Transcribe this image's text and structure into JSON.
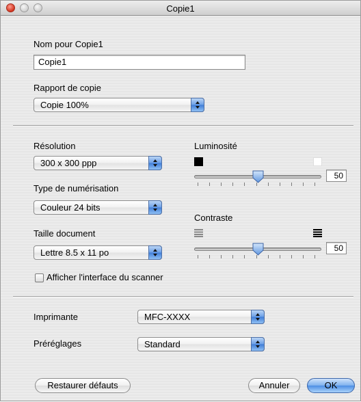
{
  "window": {
    "title": "Copie1"
  },
  "name_section": {
    "label": "Nom pour Copie1",
    "value": "Copie1"
  },
  "ratio": {
    "label": "Rapport de copie",
    "selected": "Copie 100%"
  },
  "resolution": {
    "label": "Résolution",
    "selected": "300 x 300 ppp"
  },
  "scan_type": {
    "label": "Type de numérisation",
    "selected": "Couleur 24 bits"
  },
  "doc_size": {
    "label": "Taille document",
    "selected": "Lettre  8.5 x 11 po"
  },
  "brightness": {
    "label": "Luminosité",
    "value": "50",
    "level": 50,
    "min": 0,
    "max": 100,
    "ticks": 11
  },
  "contrast": {
    "label": "Contraste",
    "value": "50",
    "level": 50,
    "min": 0,
    "max": 100,
    "ticks": 11
  },
  "scanner_ui": {
    "label": "Afficher l'interface du scanner",
    "checked": false
  },
  "printer": {
    "label": "Imprimante",
    "selected": "MFC-XXXX"
  },
  "presets": {
    "label": "Préréglages",
    "selected": "Standard"
  },
  "buttons": {
    "restore": "Restaurer défauts",
    "cancel": "Annuler",
    "ok": "OK"
  }
}
